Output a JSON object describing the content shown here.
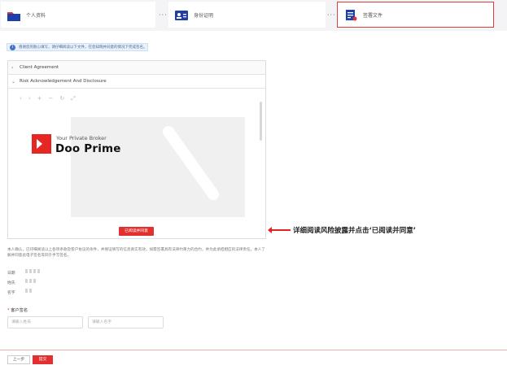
{
  "steps": [
    {
      "label": "个人资料"
    },
    {
      "label": "身份证明"
    },
    {
      "label": "签署文件"
    }
  ],
  "separator": "···",
  "notice": {
    "icon": "info-icon",
    "text": "感谢您的耐心填写，请仔细阅读以下文件，在您知晓并同意的情况下完成签名。"
  },
  "accordion": [
    {
      "label": "Client Agreement",
      "icon": "chevron-right-icon"
    },
    {
      "label": "Risk Acknowledgement And Disclosure",
      "icon": "chevron-down-icon"
    }
  ],
  "viewer_tools": [
    "‹",
    "›",
    "+",
    "−",
    "↻",
    "⤢"
  ],
  "logo": {
    "tagline": "Your Private Broker",
    "name": "Doo Prime"
  },
  "read_button": "已阅读并同意",
  "annotation": "详细阅读风险披露并点击‘已阅读并同意’",
  "paragraph": "本人确认，已仔细阅读以上各项条款及客户协议的条件，并保证填写的信息真实有效，如需签署具有法律约束力的合约，并为此承担相应的法律责任。本人了解并同意此电子签名等同于手写签名。",
  "info_rows": [
    {
      "label": "日期"
    },
    {
      "label": "姓氏"
    },
    {
      "label": "名字"
    }
  ],
  "signature": {
    "required_mark": "*",
    "label": "客户签名",
    "last_name_placeholder": "请输入姓氏",
    "first_name_placeholder": "请输入名字"
  },
  "buttons": {
    "prev": "上一步",
    "submit": "提交"
  },
  "colors": {
    "accent": "#e23030",
    "notice_bg": "#e9f1fb"
  }
}
